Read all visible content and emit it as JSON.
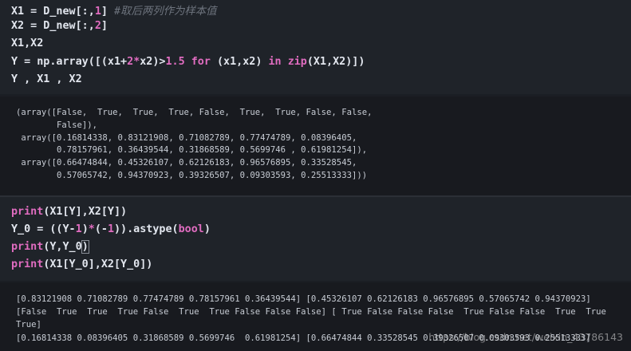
{
  "cell1": {
    "lines": [
      {
        "parts": [
          [
            "t-txt",
            "X1 = D_new[:,"
          ],
          [
            "t-num",
            "1"
          ],
          [
            "t-txt",
            "] "
          ],
          [
            "t-cmt",
            "#取后两列作为样本值"
          ]
        ]
      },
      {
        "parts": [
          [
            "t-txt",
            "X2 = D_new[:,"
          ],
          [
            "t-num",
            "2"
          ],
          [
            "t-txt",
            "]"
          ]
        ]
      },
      {
        "parts": [
          [
            "t-txt",
            "X1,X2"
          ]
        ]
      },
      {
        "parts": [
          [
            "t-txt",
            "Y = np.array([(x1+"
          ],
          [
            "t-num",
            "2"
          ],
          [
            "t-op",
            "*"
          ],
          [
            "t-txt",
            "x2)>"
          ],
          [
            "t-num",
            "1.5"
          ],
          [
            "t-txt",
            " "
          ],
          [
            "t-kw",
            "for"
          ],
          [
            "t-txt",
            " (x1,x2) "
          ],
          [
            "t-kw",
            "in"
          ],
          [
            "t-txt",
            " "
          ],
          [
            "t-fn",
            "zip"
          ],
          [
            "t-txt",
            "(X1,X2)])"
          ]
        ]
      },
      {
        "parts": [
          [
            "t-txt",
            "Y , X1 , X2"
          ]
        ]
      }
    ]
  },
  "output1": [
    "(array([False,  True,  True,  True, False,  True,  True, False, False,",
    "        False]),",
    " array([0.16814338, 0.83121908, 0.71082789, 0.77474789, 0.08396405,",
    "        0.78157961, 0.36439544, 0.31868589, 0.5699746 , 0.61981254]),",
    " array([0.66474844, 0.45326107, 0.62126183, 0.96576895, 0.33528545,",
    "        0.57065742, 0.94370923, 0.39326507, 0.09303593, 0.25513333]))"
  ],
  "cell2": {
    "lines": [
      {
        "parts": [
          [
            "t-fn",
            "print"
          ],
          [
            "t-txt",
            "(X1[Y],X2[Y])"
          ]
        ]
      },
      {
        "parts": [
          [
            "t-txt",
            "Y_0 = ((Y-"
          ],
          [
            "t-num",
            "1"
          ],
          [
            "t-txt",
            ")"
          ],
          [
            "t-op",
            "*"
          ],
          [
            "t-txt",
            "(-"
          ],
          [
            "t-num",
            "1"
          ],
          [
            "t-txt",
            ")).astype("
          ],
          [
            "t-fn",
            "bool"
          ],
          [
            "t-txt",
            ")"
          ]
        ]
      },
      {
        "parts": [
          [
            "t-fn",
            "print"
          ],
          [
            "t-txt",
            "(Y,Y_0"
          ],
          [
            "cursor-paren t-txt",
            ")"
          ]
        ]
      },
      {
        "parts": [
          [
            "t-fn",
            "print"
          ],
          [
            "t-txt",
            "(X1[Y_0],X2[Y_0])"
          ]
        ]
      }
    ]
  },
  "output2": [
    "[0.83121908 0.71082789 0.77474789 0.78157961 0.36439544] [0.45326107 0.62126183 0.96576895 0.57065742 0.94370923]",
    "[False  True  True  True False  True  True False False False] [ True False False False  True False False  True  True",
    "True]",
    "[0.16814338 0.08396405 0.31868589 0.5699746  0.61981254] [0.66474844 0.33528545 0.39326507 0.09303593 0.25513333]"
  ],
  "watermark": "https://blog.csdn.net/weixin_43786143"
}
